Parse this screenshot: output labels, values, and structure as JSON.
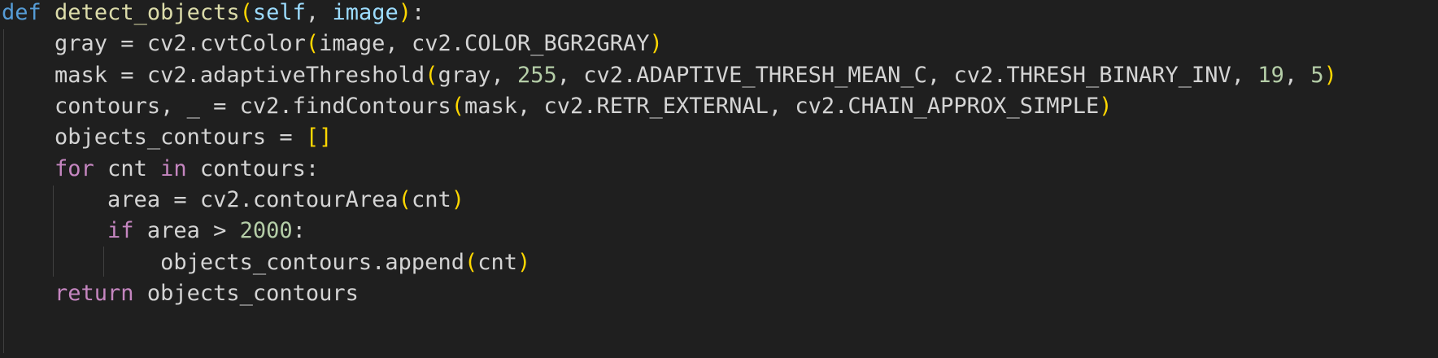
{
  "editor": {
    "language": "python",
    "theme_colors": {
      "background": "#1f1f1f",
      "keyword_def": "#569cd6",
      "keyword_control": "#c586c0",
      "function": "#dcdcaa",
      "variable": "#9cdcfe",
      "plain": "#d4d4d4",
      "number": "#b5cea8",
      "bracket_level1": "#ffd700"
    },
    "lines": [
      {
        "indent": "",
        "tokens": [
          {
            "t": "def",
            "c": "kw"
          },
          {
            "t": " ",
            "c": "plain"
          },
          {
            "t": "detect_objects",
            "c": "fn"
          },
          {
            "t": "(",
            "c": "br1"
          },
          {
            "t": "self",
            "c": "var"
          },
          {
            "t": ", ",
            "c": "plain"
          },
          {
            "t": "image",
            "c": "var"
          },
          {
            "t": ")",
            "c": "br1"
          },
          {
            "t": ":",
            "c": "plain"
          }
        ]
      },
      {
        "indent": "    ",
        "tokens": [
          {
            "t": "gray = cv2.cvtColor",
            "c": "plain"
          },
          {
            "t": "(",
            "c": "br1"
          },
          {
            "t": "image, cv2.COLOR_BGR2GRAY",
            "c": "plain"
          },
          {
            "t": ")",
            "c": "br1"
          }
        ]
      },
      {
        "indent": "    ",
        "tokens": [
          {
            "t": "mask = cv2.adaptiveThreshold",
            "c": "plain"
          },
          {
            "t": "(",
            "c": "br1"
          },
          {
            "t": "gray, ",
            "c": "plain"
          },
          {
            "t": "255",
            "c": "num"
          },
          {
            "t": ", cv2.ADAPTIVE_THRESH_MEAN_C, cv2.THRESH_BINARY_INV, ",
            "c": "plain"
          },
          {
            "t": "19",
            "c": "num"
          },
          {
            "t": ", ",
            "c": "plain"
          },
          {
            "t": "5",
            "c": "num"
          },
          {
            "t": ")",
            "c": "br1"
          }
        ]
      },
      {
        "indent": "    ",
        "tokens": [
          {
            "t": "contours, _ = cv2.findContours",
            "c": "plain"
          },
          {
            "t": "(",
            "c": "br1"
          },
          {
            "t": "mask, cv2.RETR_EXTERNAL, cv2.CHAIN_APPROX_SIMPLE",
            "c": "plain"
          },
          {
            "t": ")",
            "c": "br1"
          }
        ]
      },
      {
        "indent": "    ",
        "tokens": [
          {
            "t": "objects_contours = ",
            "c": "plain"
          },
          {
            "t": "[]",
            "c": "br1"
          }
        ]
      },
      {
        "indent": "    ",
        "tokens": [
          {
            "t": "for",
            "c": "ctrl"
          },
          {
            "t": " cnt ",
            "c": "plain"
          },
          {
            "t": "in",
            "c": "ctrl"
          },
          {
            "t": " contours:",
            "c": "plain"
          }
        ]
      },
      {
        "indent": "        ",
        "tokens": [
          {
            "t": "area = cv2.contourArea",
            "c": "plain"
          },
          {
            "t": "(",
            "c": "br1"
          },
          {
            "t": "cnt",
            "c": "plain"
          },
          {
            "t": ")",
            "c": "br1"
          }
        ]
      },
      {
        "indent": "        ",
        "tokens": [
          {
            "t": "if",
            "c": "ctrl"
          },
          {
            "t": " area > ",
            "c": "plain"
          },
          {
            "t": "2000",
            "c": "num"
          },
          {
            "t": ":",
            "c": "plain"
          }
        ]
      },
      {
        "indent": "            ",
        "tokens": [
          {
            "t": "objects_contours.append",
            "c": "plain"
          },
          {
            "t": "(",
            "c": "br1"
          },
          {
            "t": "cnt",
            "c": "plain"
          },
          {
            "t": ")",
            "c": "br1"
          }
        ]
      },
      {
        "indent": "    ",
        "tokens": [
          {
            "t": "return",
            "c": "ctrl"
          },
          {
            "t": " objects_contours",
            "c": "plain"
          }
        ]
      }
    ]
  }
}
